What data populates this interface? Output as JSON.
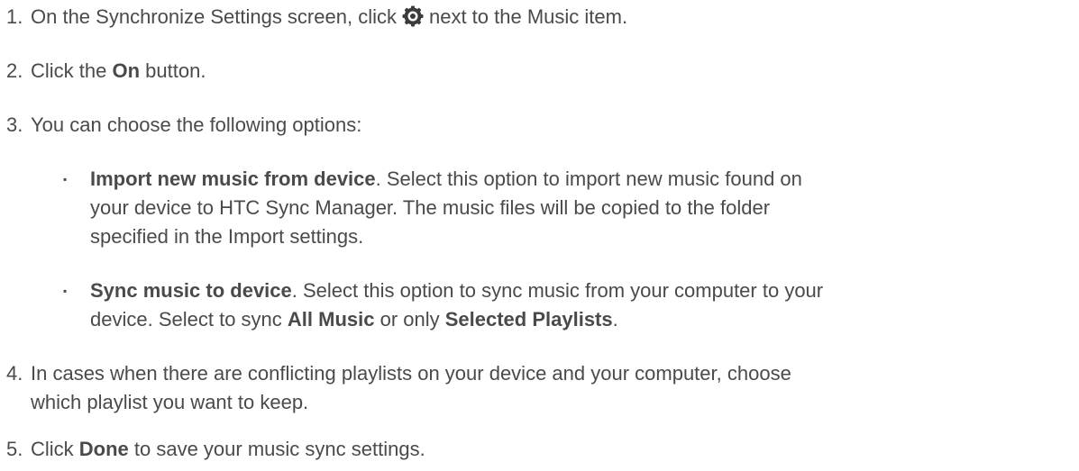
{
  "steps": [
    {
      "num": "1.",
      "t1": "On the Synchronize Settings screen, click",
      "t2": "next to the Music item.",
      "icon": "gear-icon"
    },
    {
      "num": "2.",
      "t1": "Click the ",
      "b1": "On",
      "t2": " button."
    },
    {
      "num": "3.",
      "t1": "You can choose the following options:",
      "options": [
        {
          "bullet": "▪",
          "b1": "Import new music from device",
          "l1": ". Select this option to import new music found on",
          "l2": "your device to HTC Sync Manager. The music files will be copied to the folder",
          "l3": "specified in the Import settings."
        },
        {
          "bullet": "▪",
          "b1": "Sync music to device",
          "l1": ". Select this option to sync music from your computer to your",
          "l2a": "device. Select to sync ",
          "b2": "All Music",
          "l2b": " or only ",
          "b3": "Selected Playlists",
          "l2c": "."
        }
      ]
    },
    {
      "num": "4.",
      "l1": "In cases when there are conflicting playlists on your device and your computer, choose",
      "l2": "which playlist you want to keep."
    },
    {
      "num": "5.",
      "t1": "Click ",
      "b1": "Done",
      "t2": " to save your music sync settings."
    }
  ]
}
